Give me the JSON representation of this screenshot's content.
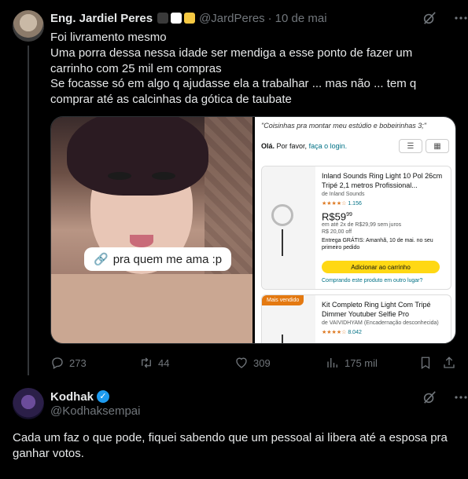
{
  "tweet": {
    "author_name": "Eng. Jardiel Peres",
    "handle": "@JardPeres",
    "separator": "·",
    "date": "10 de mai",
    "badge_colors": [
      "#3a3a3a",
      "#ffffff",
      "#f5c842"
    ],
    "text": "Foi livramento mesmo\nUma porra dessa nessa idade ser mendiga a esse ponto de fazer um carrinho com 25 mil em compras\nSe focasse só em algo q ajudasse ela a trabalhar ... mas não ... tem q comprar até as calcinhas da gótica de taubate",
    "media": {
      "photo_caption": "pra quem me ama :p",
      "shop": {
        "quote": "\"Coisinhas pra montar meu estúdio e bobeirinhas 3;\"",
        "login_prefix": "Olá.",
        "login_text": "Por favor,",
        "login_link": "faça o login.",
        "products": [
          {
            "title": "Inland Sounds Ring Light 10 Pol 26cm Tripé 2,1 metros Profissional...",
            "brand": "de Inland Sounds",
            "rating": "★★★★☆",
            "reviews": "1.156",
            "price_main": "R$59",
            "price_cents": "99",
            "installments": "em até 2x de R$29,99 sem juros",
            "shipping": "R$ 20,00 off",
            "delivery": "Entrega GRÁTIS: Amanhã, 10 de mai. no seu primeiro pedido",
            "add_label": "Adicionar ao carrinho",
            "compare": "Comprando este produto em outro lugar?"
          },
          {
            "badge": "Mais vendido",
            "title": "Kit Completo Ring Light Com Tripé Dimmer Youtuber Selfie Pro",
            "brand": "de VAIVIDHYAM (Encadernação desconhecida)",
            "rating": "★★★★☆",
            "reviews": "8.042"
          }
        ]
      }
    },
    "actions": {
      "replies": "273",
      "retweets": "44",
      "likes": "309",
      "views": "175 mil"
    }
  },
  "reply": {
    "author_name": "Kodhak",
    "handle": "@Kodhaksempai",
    "text": "Cada um faz o que pode, fiquei sabendo que um pessoal ai libera até a esposa pra ganhar votos."
  },
  "colors": {
    "background": "#000000",
    "text": "#e7e9ea",
    "muted": "#71767b",
    "accent": "#1d9bf0"
  }
}
